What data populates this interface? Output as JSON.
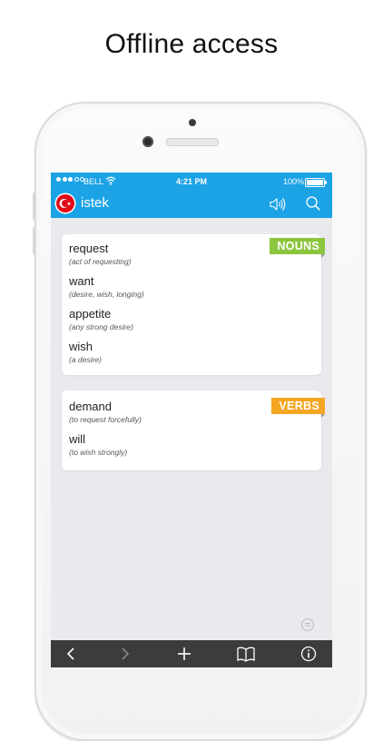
{
  "headline": "Offline access",
  "status_bar": {
    "carrier": "BELL",
    "time": "4:21 PM",
    "battery": "100%"
  },
  "navbar": {
    "title": "istek",
    "flag": "turkey-flag-icon",
    "icons": [
      "speaker-icon",
      "search-icon"
    ]
  },
  "sections": [
    {
      "tag": "NOUNS",
      "tag_color": "#8cc63e",
      "entries": [
        {
          "word": "request",
          "gloss": "(act of requesting)"
        },
        {
          "word": "want",
          "gloss": "(desire, wish, longing)"
        },
        {
          "word": "appetite",
          "gloss": "(any strong desire)"
        },
        {
          "word": "wish",
          "gloss": "(a desire)"
        }
      ]
    },
    {
      "tag": "VERBS",
      "tag_color": "#f5a623",
      "entries": [
        {
          "word": "demand",
          "gloss": "(to request forcefully)"
        },
        {
          "word": "will",
          "gloss": "(to wish strongly)"
        }
      ]
    }
  ],
  "toolbar": {
    "items": [
      "back-icon",
      "forward-icon",
      "add-icon",
      "book-icon",
      "info-icon"
    ]
  },
  "colors": {
    "accent": "#1ba3e6",
    "toolbar": "#3c3c3c",
    "content_bg": "#e9e9ee"
  }
}
